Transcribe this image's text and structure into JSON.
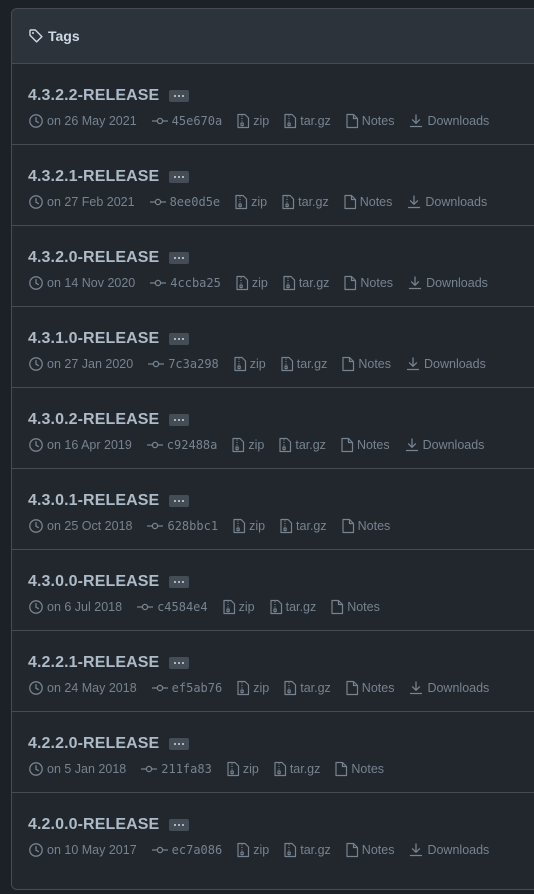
{
  "header": {
    "title": "Tags"
  },
  "tags": [
    {
      "name": "4.3.2.2-RELEASE",
      "date": "on 26 May 2021",
      "sha": "45e670a",
      "downloads": true
    },
    {
      "name": "4.3.2.1-RELEASE",
      "date": "on 27 Feb 2021",
      "sha": "8ee0d5e",
      "downloads": true
    },
    {
      "name": "4.3.2.0-RELEASE",
      "date": "on 14 Nov 2020",
      "sha": "4ccba25",
      "downloads": true
    },
    {
      "name": "4.3.1.0-RELEASE",
      "date": "on 27 Jan 2020",
      "sha": "7c3a298",
      "downloads": true
    },
    {
      "name": "4.3.0.2-RELEASE",
      "date": "on 16 Apr 2019",
      "sha": "c92488a",
      "downloads": true
    },
    {
      "name": "4.3.0.1-RELEASE",
      "date": "on 25 Oct 2018",
      "sha": "628bbc1",
      "downloads": false
    },
    {
      "name": "4.3.0.0-RELEASE",
      "date": "on 6 Jul 2018",
      "sha": "c4584e4",
      "downloads": false
    },
    {
      "name": "4.2.2.1-RELEASE",
      "date": "on 24 May 2018",
      "sha": "ef5ab76",
      "downloads": true
    },
    {
      "name": "4.2.2.0-RELEASE",
      "date": "on 5 Jan 2018",
      "sha": "211fa83",
      "downloads": false
    },
    {
      "name": "4.2.0.0-RELEASE",
      "date": "on 10 May 2017",
      "sha": "ec7a086",
      "downloads": true
    }
  ],
  "labels": {
    "zip": "zip",
    "targz": "tar.gz",
    "notes": "Notes",
    "downloads": "Downloads"
  },
  "icons": [
    "tag-icon",
    "clock-icon",
    "commit-icon",
    "file-zip-icon",
    "file-icon",
    "download-icon"
  ],
  "colors": {
    "background": "#1c2128",
    "panel": "#22272e",
    "header": "#2d333b",
    "border": "#444c56",
    "text": "#adbac7",
    "muted": "#768390"
  }
}
